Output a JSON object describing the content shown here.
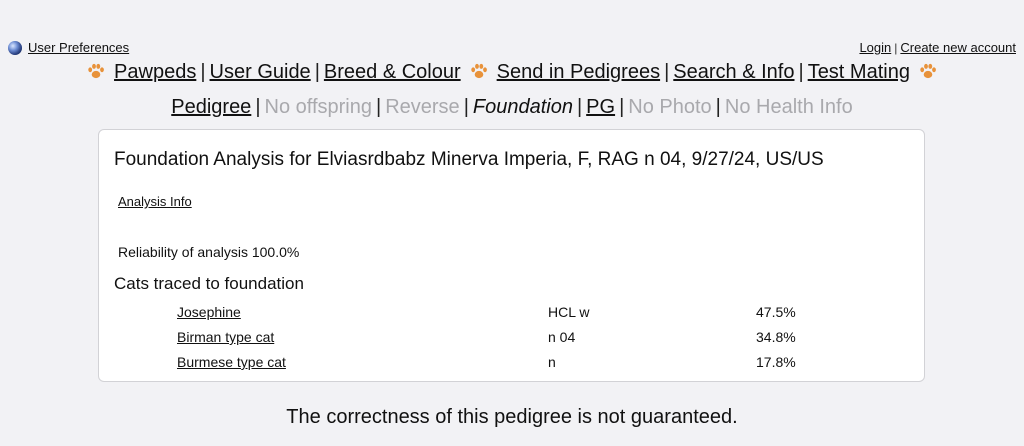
{
  "top": {
    "user_prefs": "User Preferences",
    "login": "Login",
    "create_account": "Create new account"
  },
  "nav1": {
    "pawpeds": "Pawpeds",
    "user_guide": "User Guide",
    "breed_colour": "Breed & Colour",
    "send_pedigrees": "Send in Pedigrees",
    "search_info": "Search & Info",
    "test_mating": "Test Mating"
  },
  "nav2": {
    "pedigree": "Pedigree",
    "no_offspring": "No offspring",
    "reverse": "Reverse",
    "foundation": "Foundation",
    "pg": "PG",
    "no_photo": "No Photo",
    "no_health": "No Health Info"
  },
  "main": {
    "title": "Foundation Analysis for Elviasrdbabz Minerva Imperia, F, RAG n 04, 9/27/24, US/US",
    "analysis_info": "Analysis Info",
    "reliability": "Reliability of analysis 100.0%",
    "subtitle": "Cats traced to foundation",
    "rows": [
      {
        "name": "Josephine",
        "code": "HCL w",
        "pct": "47.5%"
      },
      {
        "name": "Birman type cat",
        "code": "n 04",
        "pct": "34.8%"
      },
      {
        "name": "Burmese type cat",
        "code": "n",
        "pct": "17.8%"
      }
    ]
  },
  "disclaimer": "The correctness of this pedigree is not guaranteed.",
  "colors": {
    "paw": "#e8923a",
    "disabled": "#a9a9ad",
    "background": "#f2f2f5"
  },
  "icons": [
    "globe-icon",
    "paw-icon"
  ]
}
